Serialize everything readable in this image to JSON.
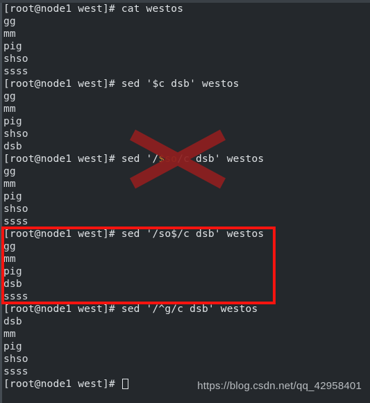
{
  "window": {
    "type": "terminal",
    "background_color": "#24282c",
    "foreground_color": "#d6dade",
    "chrome_color": "#3a4046"
  },
  "terminal": {
    "prompt": "[root@node1 west]# ",
    "lines": [
      {
        "kind": "prompt",
        "prompt": "[root@node1 west]# ",
        "command": "cat westos"
      },
      {
        "kind": "output",
        "text": "gg"
      },
      {
        "kind": "output",
        "text": "mm"
      },
      {
        "kind": "output",
        "text": "pig"
      },
      {
        "kind": "output",
        "text": "shso"
      },
      {
        "kind": "output",
        "text": "ssss"
      },
      {
        "kind": "prompt",
        "prompt": "[root@node1 west]# ",
        "command": "sed '$c dsb' westos"
      },
      {
        "kind": "output",
        "text": "gg"
      },
      {
        "kind": "output",
        "text": "mm"
      },
      {
        "kind": "output",
        "text": "pig"
      },
      {
        "kind": "output",
        "text": "shso"
      },
      {
        "kind": "output",
        "text": "dsb"
      },
      {
        "kind": "prompt",
        "prompt": "[root@node1 west]# ",
        "command_pre": "sed '/",
        "command_var": "$so",
        "command_post": "/c dsb' westos"
      },
      {
        "kind": "output",
        "text": "gg"
      },
      {
        "kind": "output",
        "text": "mm"
      },
      {
        "kind": "output",
        "text": "pig"
      },
      {
        "kind": "output",
        "text": "shso"
      },
      {
        "kind": "output",
        "text": "ssss"
      },
      {
        "kind": "prompt",
        "prompt": "[root@node1 west]# ",
        "command": "sed '/so$/c dsb' westos"
      },
      {
        "kind": "output",
        "text": "gg"
      },
      {
        "kind": "output",
        "text": "mm"
      },
      {
        "kind": "output",
        "text": "pig"
      },
      {
        "kind": "output",
        "text": "dsb"
      },
      {
        "kind": "output",
        "text": "ssss"
      },
      {
        "kind": "prompt",
        "prompt": "[root@node1 west]# ",
        "command": "sed '/^g/c dsb' westos"
      },
      {
        "kind": "output",
        "text": "dsb"
      },
      {
        "kind": "output",
        "text": "mm"
      },
      {
        "kind": "output",
        "text": "pig"
      },
      {
        "kind": "output",
        "text": "shso"
      },
      {
        "kind": "output",
        "text": "ssss"
      },
      {
        "kind": "prompt_cursor",
        "prompt": "[root@node1 west]# ",
        "command": ""
      }
    ]
  },
  "annotations": {
    "cross_out": {
      "name": "red-x-mark",
      "color": "#8f1f1f",
      "meaning": "incorrect-command"
    },
    "highlight_box": {
      "name": "red-highlight-box",
      "color": "#f5140f",
      "meaning": "correct-command"
    }
  },
  "watermark": {
    "text": "https://blog.csdn.net/qq_42958401",
    "color": "#b9bdc1"
  }
}
